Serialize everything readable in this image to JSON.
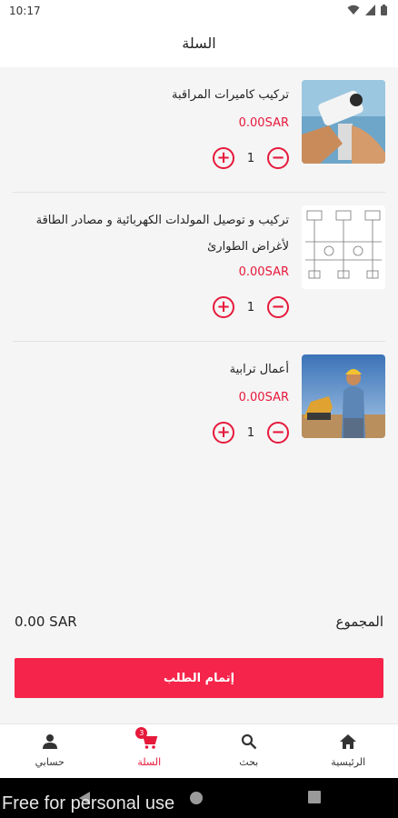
{
  "status": {
    "time": "10:17"
  },
  "header": {
    "title": "السلة"
  },
  "items": [
    {
      "name": "تركيب كاميرات المراقبة",
      "price": "0.00SAR",
      "quantity": "1"
    },
    {
      "name": "تركيب و توصيل المولدات الكهربائية و مصادر الطاقة لأغراض الطوارئ",
      "price": "0.00SAR",
      "quantity": "1"
    },
    {
      "name": "أعمال ترابية",
      "price": "0.00SAR",
      "quantity": "1"
    }
  ],
  "summary": {
    "total_label": "المجموع",
    "total_value": "0.00 SAR"
  },
  "checkout": {
    "label": "إتمام الطلب"
  },
  "nav": {
    "badge": "3",
    "items": [
      {
        "label": "الرئيسية",
        "icon": "home-icon"
      },
      {
        "label": "بحث",
        "icon": "search-icon"
      },
      {
        "label": "السلة",
        "icon": "cart-icon"
      },
      {
        "label": "حسابي",
        "icon": "person-icon"
      }
    ]
  },
  "watermark": "Free for personal use",
  "colors": {
    "accent": "#e6193b",
    "button": "#f5244a"
  }
}
